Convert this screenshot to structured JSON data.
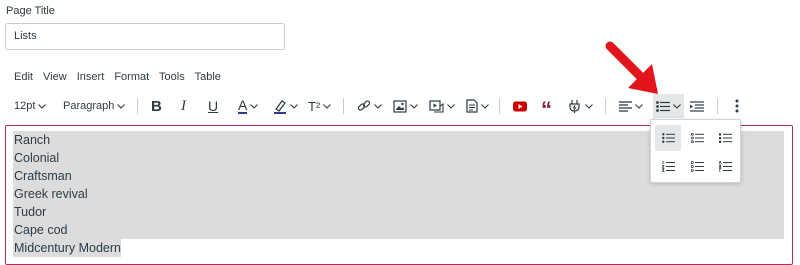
{
  "page_title": {
    "label": "Page Title",
    "value": "Lists"
  },
  "menubar": [
    "Edit",
    "View",
    "Insert",
    "Format",
    "Tools",
    "Table"
  ],
  "toolbar": {
    "font_size": "12pt",
    "block_format": "Paragraph",
    "icons": [
      "bold-icon",
      "italic-icon",
      "underline-icon",
      "text-color-icon",
      "highlight-icon",
      "superscript-icon",
      "link-icon",
      "image-icon",
      "media-icon",
      "document-icon",
      "youtube-icon",
      "quote-icon",
      "plugin-icon",
      "align-icon",
      "bullet-list-icon",
      "indent-icon",
      "more-icon"
    ],
    "bold": "B",
    "italic": "I",
    "underline": "U",
    "text_color": "A",
    "superscript": "T²",
    "quote": "“"
  },
  "editor": {
    "lines": [
      "Ranch",
      "Colonial",
      "Craftsman",
      "Greek revival",
      "Tudor",
      "Cape cod",
      "Midcentury Modern"
    ]
  },
  "list_dropdown": {
    "options": [
      "default-bullets",
      "circle-bullets",
      "square-bullets",
      "numbered",
      "lower-alpha",
      "upper-alpha"
    ],
    "selected": "default-bullets"
  },
  "colors": {
    "accent": "#b32f5a",
    "arrow": "#e2141c",
    "youtube": "#cc0000",
    "quote": "#8b1a3b",
    "selection": "#dcdcdc"
  }
}
